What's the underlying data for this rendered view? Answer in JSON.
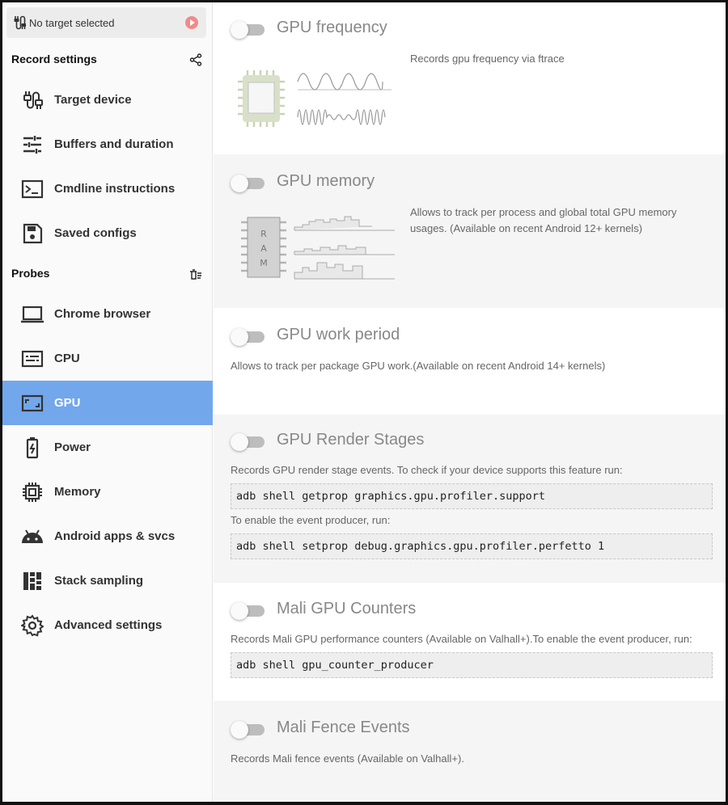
{
  "sidebar": {
    "target_label": "No target selected",
    "record_settings_title": "Record settings",
    "probes_title": "Probes",
    "record_items": [
      {
        "label": "Target device",
        "icon": "cable-icon"
      },
      {
        "label": "Buffers and duration",
        "icon": "tune-icon"
      },
      {
        "label": "Cmdline instructions",
        "icon": "terminal-icon"
      },
      {
        "label": "Saved configs",
        "icon": "save-icon"
      }
    ],
    "probe_items": [
      {
        "label": "Chrome browser",
        "icon": "laptop-icon"
      },
      {
        "label": "CPU",
        "icon": "cpu-icon"
      },
      {
        "label": "GPU",
        "icon": "gpu-icon",
        "active": true
      },
      {
        "label": "Power",
        "icon": "battery-icon"
      },
      {
        "label": "Memory",
        "icon": "memory-icon"
      },
      {
        "label": "Android apps & svcs",
        "icon": "android-icon"
      },
      {
        "label": "Stack sampling",
        "icon": "stack-sampling-icon"
      },
      {
        "label": "Advanced settings",
        "icon": "gear-icon"
      }
    ],
    "colors": {
      "active": "#72a7ec"
    }
  },
  "probes": [
    {
      "title": "GPU frequency",
      "enabled": false,
      "description": "Records gpu frequency via ftrace"
    },
    {
      "title": "GPU memory",
      "enabled": false,
      "description": "Allows to track per process and global total GPU memory usages. (Available on recent Android 12+ kernels)"
    },
    {
      "title": "GPU work period",
      "enabled": false,
      "description": "Allows to track per package GPU work.(Available on recent Android 14+ kernels)"
    },
    {
      "title": "GPU Render Stages",
      "enabled": false,
      "description": "Records GPU render stage events. To check if your device supports this feature run:",
      "code1": "adb shell getprop graphics.gpu.profiler.support",
      "note": "To enable the event producer, run:",
      "code2": "adb shell setprop debug.graphics.gpu.profiler.perfetto 1"
    },
    {
      "title": "Mali GPU Counters",
      "enabled": false,
      "description": "Records Mali GPU performance counters (Available on Valhall+).To enable the event producer, run:",
      "code1": "adb shell gpu_counter_producer"
    },
    {
      "title": "Mali Fence Events",
      "enabled": false,
      "description": "Records Mali fence events (Available on Valhall+)."
    }
  ],
  "illustration_text": {
    "ram_letters": "RAM"
  }
}
